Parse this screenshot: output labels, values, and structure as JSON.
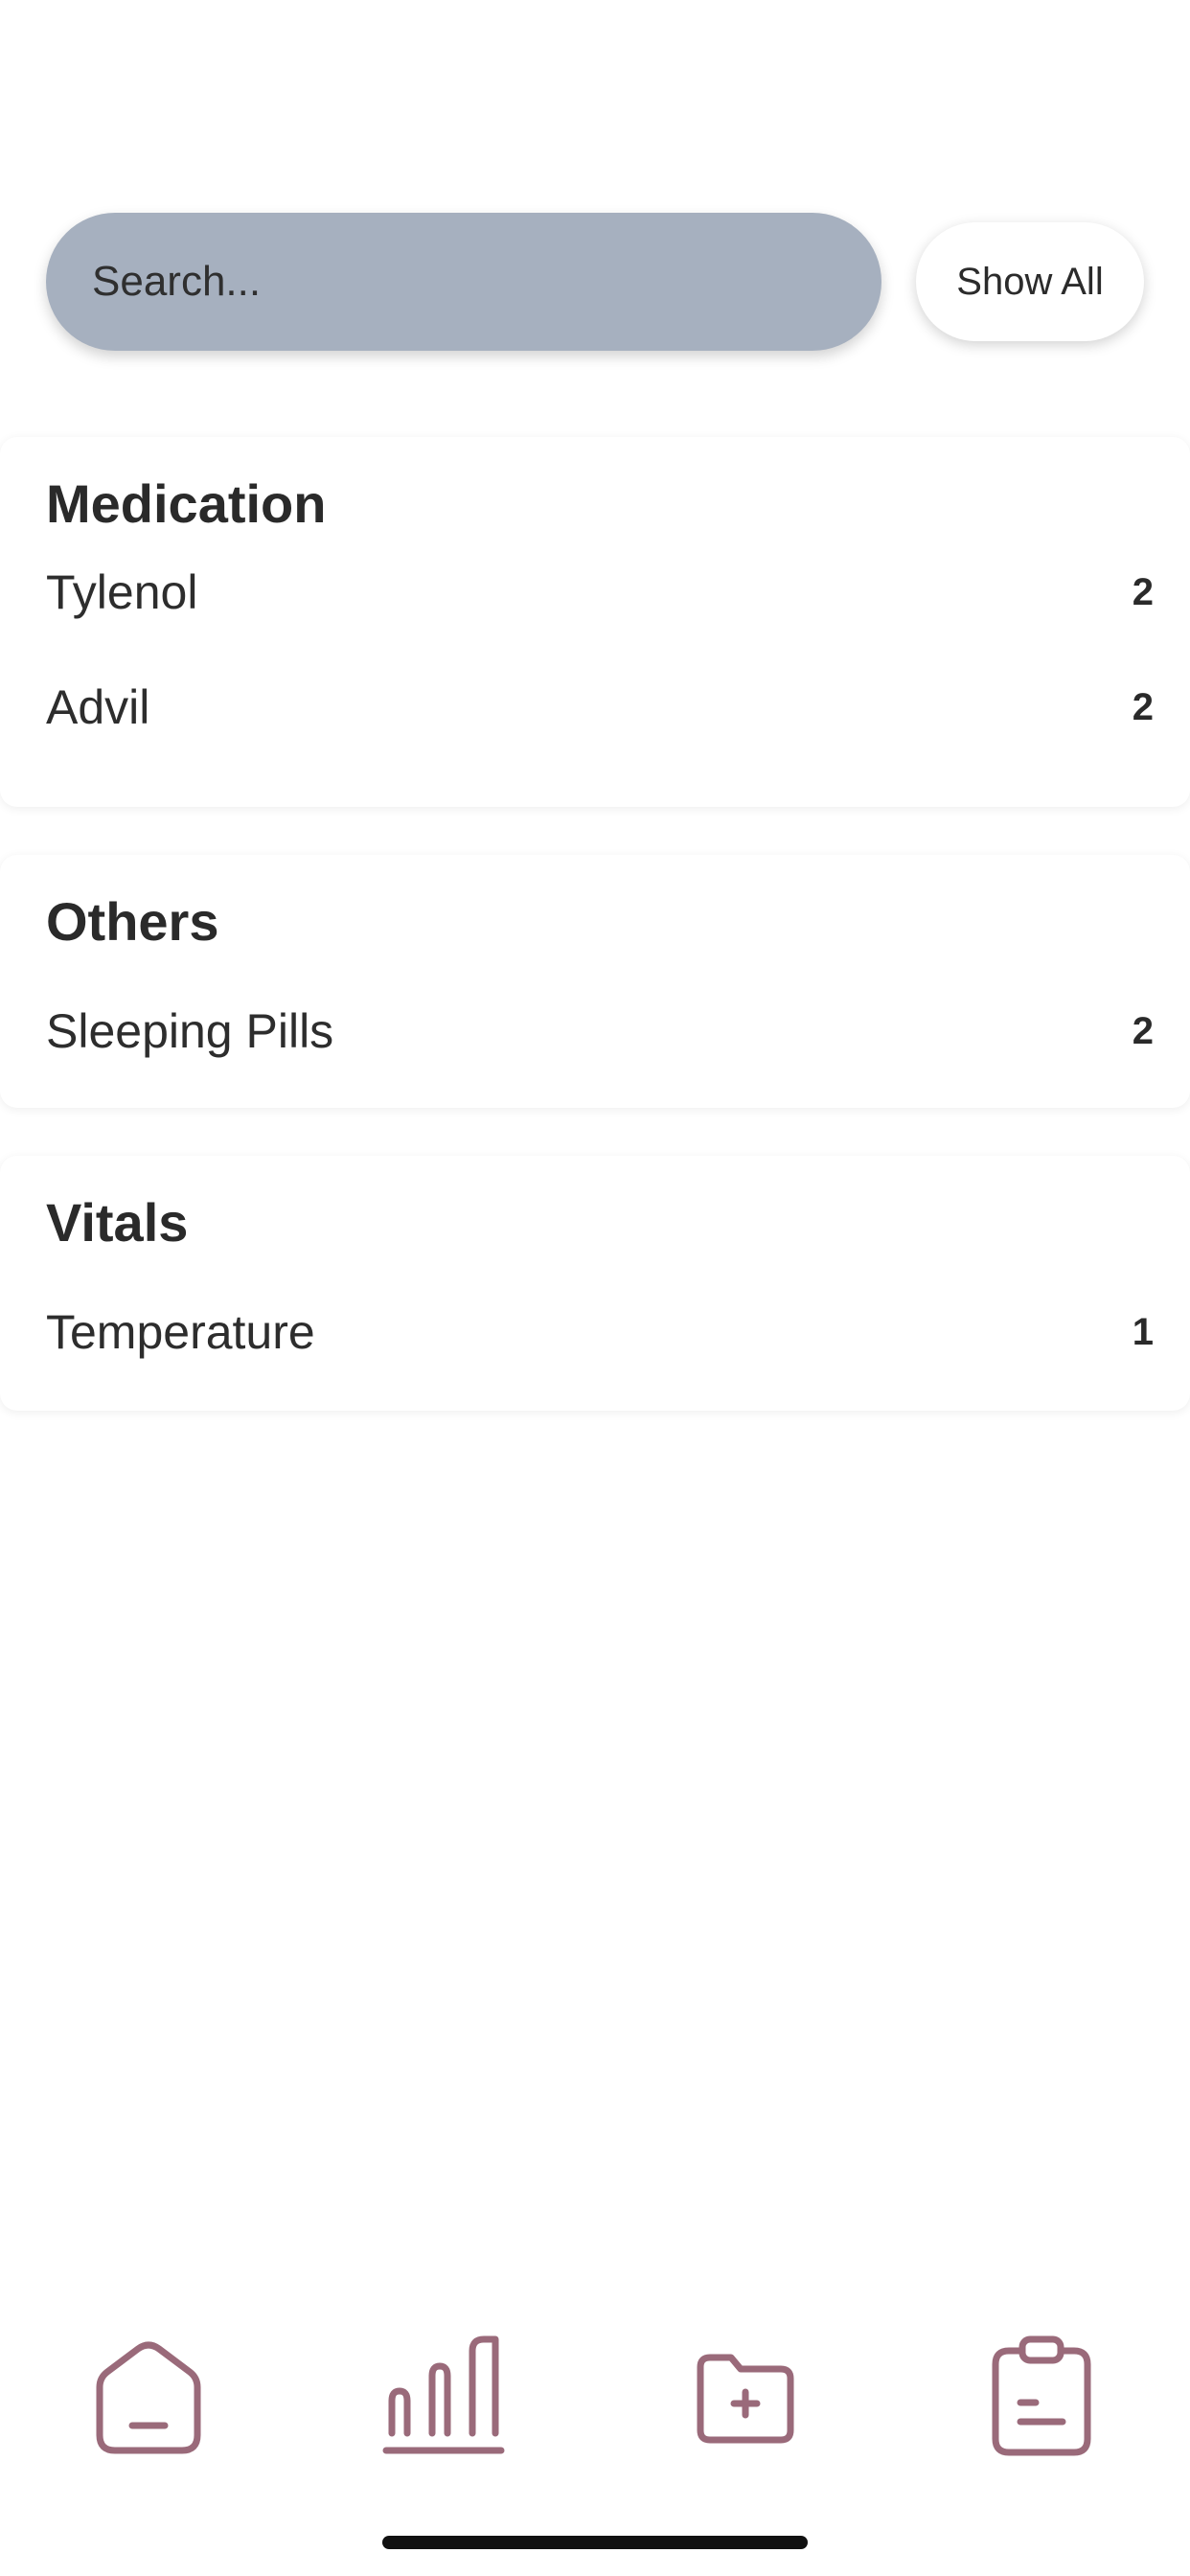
{
  "search": {
    "placeholder": "Search...",
    "show_all_label": "Show All"
  },
  "sections": [
    {
      "title": "Medication",
      "items": [
        {
          "label": "Tylenol",
          "count": "2"
        },
        {
          "label": "Advil",
          "count": "2"
        }
      ]
    },
    {
      "title": "Others",
      "items": [
        {
          "label": "Sleeping Pills",
          "count": "2"
        }
      ]
    },
    {
      "title": "Vitals",
      "items": [
        {
          "label": "Temperature",
          "count": "1"
        }
      ]
    }
  ],
  "tab_bar": {
    "tabs": [
      {
        "icon": "home-icon",
        "active": false
      },
      {
        "icon": "bar-chart-icon",
        "active": true
      },
      {
        "icon": "folder-add-icon",
        "active": false
      },
      {
        "icon": "clipboard-icon",
        "active": false
      }
    ],
    "icon_color": "#9a6a7a"
  }
}
